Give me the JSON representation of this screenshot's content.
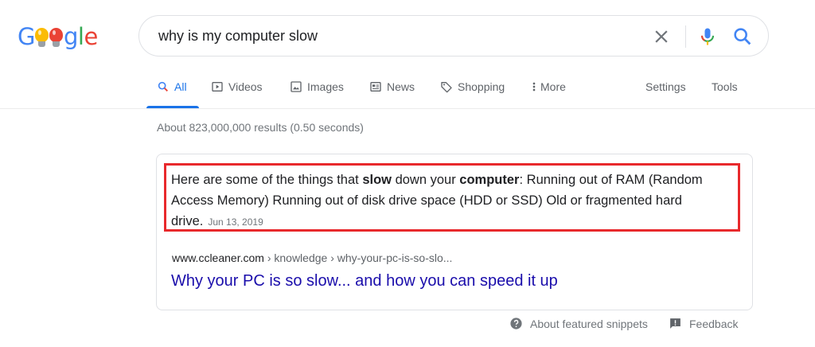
{
  "logo": {
    "letters": [
      "G",
      "",
      "",
      "g",
      "l",
      "e"
    ],
    "bulb_colors": [
      "#fbbc05",
      "#ea4335"
    ]
  },
  "search": {
    "query": "why is my computer slow"
  },
  "tabs": [
    {
      "label": "All",
      "icon": "search-icon",
      "active": true
    },
    {
      "label": "Videos",
      "icon": "play-icon"
    },
    {
      "label": "Images",
      "icon": "image-icon"
    },
    {
      "label": "News",
      "icon": "news-icon"
    },
    {
      "label": "Shopping",
      "icon": "tag-icon"
    },
    {
      "label": "More",
      "icon": "more-vert-icon"
    }
  ],
  "tools": {
    "settings": "Settings",
    "tools": "Tools"
  },
  "stats": "About 823,000,000 results (0.50 seconds)",
  "snippet": {
    "part1": "Here are some of the things that ",
    "bold1": "slow",
    "part2": " down your ",
    "bold2": "computer",
    "part3": ": Running out of RAM (Random Access Memory) Running out of disk drive space (HDD or SSD) Old or fragmented hard drive.",
    "date": "Jun 13, 2019",
    "highlight_color": "#e8292c"
  },
  "result": {
    "cite_domain": "www.ccleaner.com",
    "cite_path": " › knowledge › why-your-pc-is-so-slo...",
    "title": "Why your PC is so slow... and how you can speed it up"
  },
  "footer": {
    "about": "About featured snippets",
    "feedback": "Feedback"
  },
  "colors": {
    "blue": "#1a73e8",
    "link": "#1a0dab",
    "red": "#ea4335",
    "yellow": "#fbbc05",
    "green": "#34a853"
  }
}
